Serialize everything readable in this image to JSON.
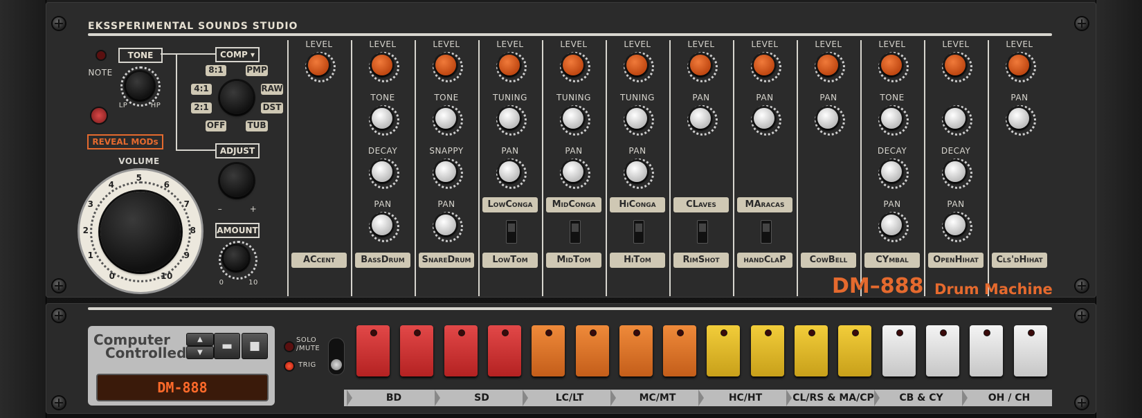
{
  "header": {
    "studio_name": "EKSSPERIMENTAL SOUNDS STUDIO"
  },
  "master": {
    "tone_label": "TONE",
    "note_label": "NOTE",
    "lp_label": "LP",
    "hp_label": "HP",
    "reveal_mods_label": "REVEAL MODs",
    "volume_label": "VOLUME",
    "volume_scale": [
      "0",
      "1",
      "2",
      "3",
      "4",
      "5",
      "6",
      "7",
      "8",
      "9",
      "10"
    ],
    "comp_label": "COMP ▾",
    "comp_modes_left": [
      "8:1",
      "4:1",
      "2:1",
      "OFF"
    ],
    "comp_modes_right": [
      "PMP",
      "RAW",
      "DST",
      "TUB"
    ],
    "adjust_label": "ADJUST",
    "adjust_minus": "–",
    "adjust_plus": "+",
    "amount_label": "AMOUNT",
    "amount_min": "0",
    "amount_max": "10"
  },
  "channels": [
    {
      "name": "ACcent",
      "knobs": [
        "LEVEL"
      ]
    },
    {
      "name": "BassDrum",
      "knobs": [
        "LEVEL",
        "TONE",
        "DECAY",
        "PAN"
      ]
    },
    {
      "name": "SnareDrum",
      "knobs": [
        "LEVEL",
        "TONE",
        "SNAPPY",
        "PAN"
      ]
    },
    {
      "name": "LowTom",
      "knobs": [
        "LEVEL",
        "TUNING",
        "PAN"
      ],
      "alt": "LowConga"
    },
    {
      "name": "MidTom",
      "knobs": [
        "LEVEL",
        "TUNING",
        "PAN"
      ],
      "alt": "MidConga"
    },
    {
      "name": "HiTom",
      "knobs": [
        "LEVEL",
        "TUNING",
        "PAN"
      ],
      "alt": "HiConga"
    },
    {
      "name": "RimShot",
      "knobs": [
        "LEVEL",
        "PAN"
      ],
      "alt": "CLaves"
    },
    {
      "name": "handClaP",
      "knobs": [
        "LEVEL",
        "PAN"
      ],
      "alt": "MAracas"
    },
    {
      "name": "CowBell",
      "knobs": [
        "LEVEL",
        "PAN"
      ]
    },
    {
      "name": "CYmbal",
      "knobs": [
        "LEVEL",
        "TONE",
        "DECAY",
        "PAN"
      ]
    },
    {
      "name": "OpenHihat",
      "knobs": [
        "LEVEL",
        "",
        "DECAY",
        "PAN"
      ]
    },
    {
      "name": "Cls'dHihat",
      "knobs": [
        "LEVEL",
        "PAN"
      ]
    }
  ],
  "brand": {
    "model": "DM–888",
    "subtitle": "Drum Machine"
  },
  "sequencer": {
    "cc_label_line1": "Computer",
    "cc_label_line2": "Controlled",
    "display_text": "DM-888",
    "solo_mute_label_1": "SOLO",
    "solo_mute_label_2": "/MUTE",
    "trig_label": "TRIG",
    "groups": [
      "BD",
      "SD",
      "LC/LT",
      "MC/MT",
      "HC/HT",
      "CL/RS & MA/CP",
      "CB & CY",
      "OH / CH"
    ],
    "pad_colors": [
      "red",
      "red",
      "red",
      "red",
      "orange",
      "orange",
      "orange",
      "orange",
      "yellow",
      "yellow",
      "yellow",
      "yellow",
      "white",
      "white",
      "white",
      "white"
    ]
  },
  "colors": {
    "accent": "#e56a2e",
    "panel": "#2b2b2b",
    "label": "#d8d6cf"
  }
}
